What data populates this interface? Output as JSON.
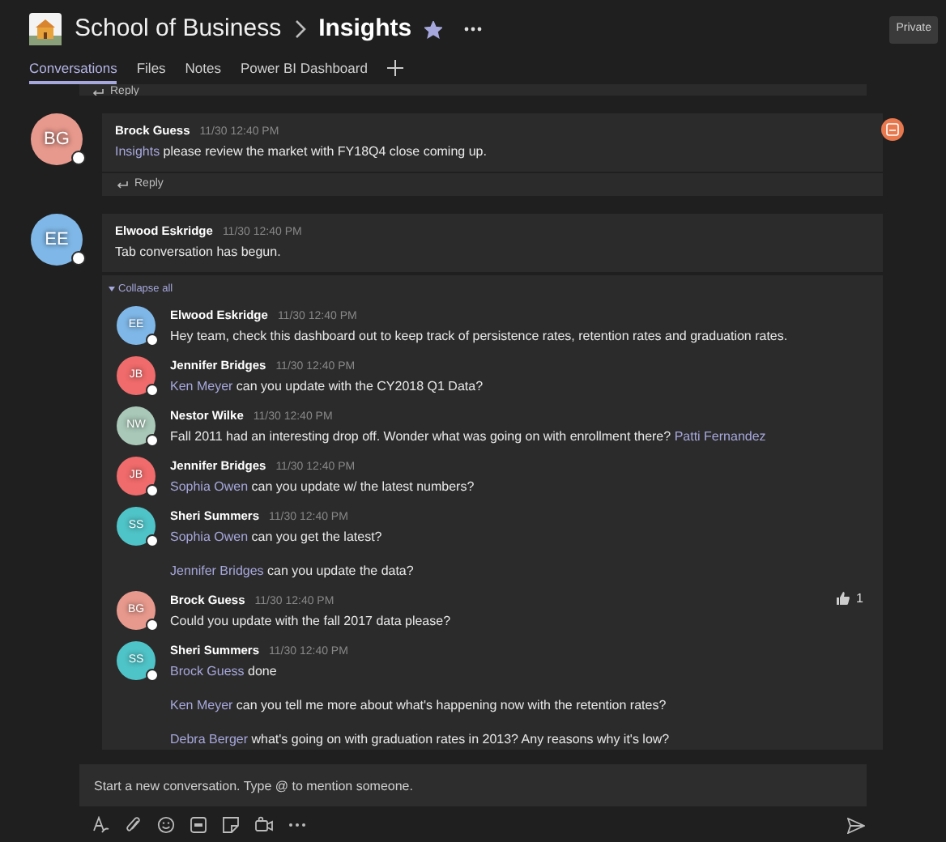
{
  "header": {
    "team": "School of Business",
    "channel": "Insights",
    "favorite": true,
    "private_label": "Private"
  },
  "tabs": [
    {
      "label": "Conversations",
      "selected": true
    },
    {
      "label": "Files",
      "selected": false
    },
    {
      "label": "Notes",
      "selected": false
    },
    {
      "label": "Power BI Dashboard",
      "selected": false
    }
  ],
  "previous_post": {
    "reply_label": "Reply"
  },
  "posts": [
    {
      "author": "Brock Guess",
      "initials": "BG",
      "color": "#e8998d",
      "time": "11/30 12:40 PM",
      "app_badge": true,
      "messages": [
        [
          {
            "kind": "mention",
            "text": "Insights"
          },
          {
            "kind": "text",
            "text": " please review the market with FY18Q4 close coming up."
          }
        ]
      ],
      "reply_label": "Reply"
    },
    {
      "author": "Elwood Eskridge",
      "initials": "EE",
      "color": "#7fb8e8",
      "time": "11/30 12:40 PM",
      "messages": [
        [
          {
            "kind": "text",
            "text": "Tab conversation has begun."
          }
        ]
      ],
      "collapse_label": "Collapse all",
      "replies": [
        {
          "author": "Elwood Eskridge",
          "initials": "EE",
          "color": "#7fb8e8",
          "time": "11/30 12:40 PM",
          "messages": [
            [
              {
                "kind": "text",
                "text": "Hey team, check this dashboard out to keep track of persistence rates, retention rates and graduation rates."
              }
            ]
          ]
        },
        {
          "author": "Jennifer Bridges",
          "initials": "JB",
          "color": "#f06b6b",
          "time": "11/30 12:40 PM",
          "messages": [
            [
              {
                "kind": "mention",
                "text": "Ken Meyer"
              },
              {
                "kind": "text",
                "text": " can you update with the CY2018 Q1 Data?"
              }
            ]
          ]
        },
        {
          "author": "Nestor Wilke",
          "initials": "NW",
          "color": "#a9c8b8",
          "time": "11/30 12:40 PM",
          "messages": [
            [
              {
                "kind": "text",
                "text": "Fall 2011 had an interesting drop off. Wonder what was going on with enrollment there? "
              },
              {
                "kind": "mention",
                "text": "Patti Fernandez"
              }
            ]
          ]
        },
        {
          "author": "Jennifer Bridges",
          "initials": "JB",
          "color": "#f06b6b",
          "time": "11/30 12:40 PM",
          "messages": [
            [
              {
                "kind": "mention",
                "text": "Sophia Owen"
              },
              {
                "kind": "text",
                "text": " can you update w/ the latest numbers?"
              }
            ]
          ]
        },
        {
          "author": "Sheri Summers",
          "initials": "SS",
          "color": "#4fc4c8",
          "time": "11/30 12:40 PM",
          "messages": [
            [
              {
                "kind": "mention",
                "text": "Sophia Owen"
              },
              {
                "kind": "text",
                "text": " can you get the latest?"
              }
            ],
            [
              {
                "kind": "mention",
                "text": "Jennifer Bridges"
              },
              {
                "kind": "text",
                "text": " can you update the data?"
              }
            ]
          ]
        },
        {
          "author": "Brock Guess",
          "initials": "BG",
          "color": "#e8998d",
          "time": "11/30 12:40 PM",
          "likes": "1",
          "messages": [
            [
              {
                "kind": "text",
                "text": "Could you update with the fall 2017 data please?"
              }
            ]
          ]
        },
        {
          "author": "Sheri Summers",
          "initials": "SS",
          "color": "#4fc4c8",
          "time": "11/30 12:40 PM",
          "messages": [
            [
              {
                "kind": "mention",
                "text": "Brock Guess"
              },
              {
                "kind": "text",
                "text": " done"
              }
            ],
            [
              {
                "kind": "mention",
                "text": "Ken Meyer"
              },
              {
                "kind": "text",
                "text": " can you tell me more about what's happening now with the retention rates?"
              }
            ],
            [
              {
                "kind": "mention",
                "text": "Debra Berger"
              },
              {
                "kind": "text",
                "text": " what's going on with graduation rates in 2013? Any reasons why it's low?"
              }
            ]
          ]
        }
      ]
    }
  ],
  "compose": {
    "placeholder": "Start a new conversation. Type @ to mention someone."
  }
}
